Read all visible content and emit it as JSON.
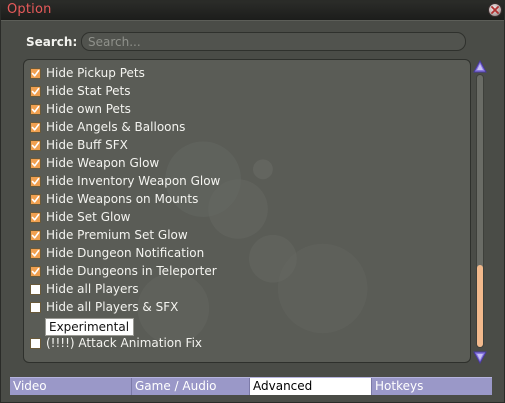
{
  "window": {
    "title": "Option"
  },
  "search": {
    "label": "Search:",
    "placeholder": "Search...",
    "value": ""
  },
  "options": [
    {
      "label": "Hide Pickup Pets",
      "checked": true
    },
    {
      "label": "Hide Stat Pets",
      "checked": true
    },
    {
      "label": "Hide own Pets",
      "checked": true
    },
    {
      "label": "Hide Angels & Balloons",
      "checked": true
    },
    {
      "label": "Hide Buff SFX",
      "checked": true
    },
    {
      "label": "Hide Weapon Glow",
      "checked": true
    },
    {
      "label": "Hide Inventory Weapon Glow",
      "checked": true
    },
    {
      "label": "Hide Weapons on Mounts",
      "checked": true
    },
    {
      "label": "Hide Set Glow",
      "checked": true
    },
    {
      "label": "Hide Premium Set Glow",
      "checked": true
    },
    {
      "label": "Hide Dungeon Notification",
      "checked": true
    },
    {
      "label": "Hide Dungeons in Teleporter",
      "checked": true
    },
    {
      "label": "Hide all Players",
      "checked": false
    },
    {
      "label": "Hide all Players & SFX",
      "checked": false
    }
  ],
  "experimental": {
    "header": "Experimental",
    "options": [
      {
        "label": "(!!!!) Attack Animation Fix",
        "checked": false
      }
    ]
  },
  "tabs": [
    {
      "label": "Video",
      "active": false
    },
    {
      "label": "Game / Audio",
      "active": false
    },
    {
      "label": "Advanced",
      "active": true
    },
    {
      "label": "Hotkeys",
      "active": false
    }
  ],
  "colors": {
    "title": "#e85a5a",
    "checkbox_fill": "#f0a050",
    "tab_bar": "#9a98c8",
    "scroll_thumb": "#f2b98c",
    "scroll_arrows": "#8a7ae0"
  },
  "icons": {
    "close": "close-x-icon",
    "scroll_up": "triangle-up-icon",
    "scroll_down": "triangle-down-icon",
    "check": "checkmark-icon"
  }
}
